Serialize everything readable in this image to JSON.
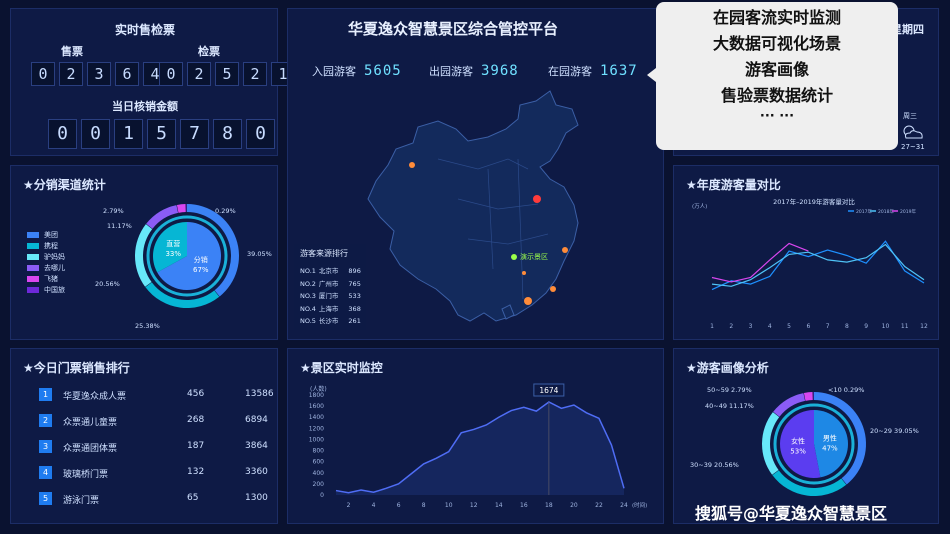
{
  "header": {
    "title": "华夏逸众智慧景区综合管控平台",
    "date_fragment": "星期四"
  },
  "ticket_panel": {
    "title": "实时售检票",
    "sale_label": "售票",
    "sale_digits": [
      "0",
      "2",
      "3",
      "6",
      "4"
    ],
    "check_label": "检票",
    "check_digits": [
      "0",
      "2",
      "5",
      "2",
      "1"
    ],
    "revenue_label": "当日核销金额",
    "revenue_digits": [
      "0",
      "0",
      "1",
      "5",
      "7",
      "8",
      "0"
    ]
  },
  "visitor_stats": [
    {
      "label": "入园游客",
      "value": "5605"
    },
    {
      "label": "出园游客",
      "value": "3968"
    },
    {
      "label": "在园游客",
      "value": "1637"
    }
  ],
  "popup": {
    "lines": [
      "在园客流实时监测",
      "大数据可视化场景",
      "游客画像",
      "售验票数据统计",
      "··· ···"
    ]
  },
  "weather": {
    "day": "周三",
    "range": "27~31"
  },
  "channel_panel": {
    "title": "★分销渠道统计",
    "legend": [
      {
        "name": "美团",
        "color": "#3b82f6"
      },
      {
        "name": "携程",
        "color": "#06b6d4"
      },
      {
        "name": "驴妈妈",
        "color": "#67e8f9"
      },
      {
        "name": "去哪儿",
        "color": "#8b5cf6"
      },
      {
        "name": "飞猪",
        "color": "#d946ef"
      },
      {
        "name": "中国旅",
        "color": "#6d28d9"
      }
    ],
    "inner": [
      {
        "label": "分销",
        "pct": "67%",
        "value": 67,
        "color": "#3b82f6"
      },
      {
        "label": "直营",
        "pct": "33%",
        "value": 33,
        "color": "#06b6d4"
      }
    ],
    "outer_values": [
      39.05,
      25.38,
      20.56,
      11.17,
      2.79,
      0.29
    ],
    "outer_colors": [
      "#3b82f6",
      "#06b6d4",
      "#67e8f9",
      "#8b5cf6",
      "#d946ef",
      "#6d28d9"
    ],
    "labels": [
      "39.05%",
      "25.38%",
      "20.56%",
      "11.17%",
      "2.79%",
      "0.29%"
    ]
  },
  "map_panel": {
    "demo_label": "演示景区",
    "source_title": "游客来源排行",
    "source_rows": [
      {
        "rank": "NO.1",
        "city": "北京市",
        "count": "896"
      },
      {
        "rank": "NO.2",
        "city": "广州市",
        "count": "765"
      },
      {
        "rank": "NO.3",
        "city": "厦门市",
        "count": "533"
      },
      {
        "rank": "NO.4",
        "city": "上海市",
        "count": "368"
      },
      {
        "rank": "NO.5",
        "city": "长沙市",
        "count": "261"
      }
    ]
  },
  "annual_panel": {
    "title": "★年度游客量对比"
  },
  "ranking_panel": {
    "title": "★今日门票销售排行",
    "rows": [
      {
        "n": "1",
        "name": "华夏逸众成人票",
        "a": "456",
        "b": "13586"
      },
      {
        "n": "2",
        "name": "众票通儿童票",
        "a": "268",
        "b": "6894"
      },
      {
        "n": "3",
        "name": "众票通团体票",
        "a": "187",
        "b": "3864"
      },
      {
        "n": "4",
        "name": "玻璃桥门票",
        "a": "132",
        "b": "3360"
      },
      {
        "n": "5",
        "name": "游泳门票",
        "a": "65",
        "b": "1300"
      }
    ]
  },
  "monitor_panel": {
    "title": "★景区实时监控"
  },
  "portrait_panel": {
    "title": "★游客画像分析",
    "inner": [
      {
        "label": "男性",
        "pct": "47%",
        "value": 47,
        "color": "#1e88e5"
      },
      {
        "label": "女性",
        "pct": "53%",
        "value": 53,
        "color": "#5b3df0"
      }
    ],
    "outer_values": [
      39.05,
      25.38,
      20.56,
      11.17,
      2.79,
      0.29
    ],
    "outer_colors": [
      "#3b82f6",
      "#06b6d4",
      "#67e8f9",
      "#8b5cf6",
      "#d946ef",
      "#6d28d9"
    ],
    "labels": [
      "20~29 39.05%",
      "30~39 20.56%",
      "40~49 11.17%",
      "50~59 2.79%",
      "<10 0.29%"
    ]
  },
  "watermark": "搜狐号@华夏逸众智慧景区",
  "chart_data": [
    {
      "type": "line",
      "title": "2017年–2019年游客量对比",
      "ylabel": "(万人)",
      "x": [
        1,
        2,
        3,
        4,
        5,
        6,
        7,
        8,
        9,
        10,
        11,
        12
      ],
      "ylim": [
        0,
        10
      ],
      "series": [
        {
          "name": "2017年",
          "color": "#1e90ff",
          "values": [
            2.4,
            3.2,
            2.9,
            3.6,
            5.9,
            5.4,
            6.0,
            5.5,
            4.8,
            6.8,
            4.1,
            3.0
          ]
        },
        {
          "name": "2018年",
          "color": "#4fc3f7",
          "values": [
            2.9,
            2.7,
            3.3,
            4.4,
            5.6,
            5.8,
            5.1,
            4.9,
            5.3,
            6.5,
            4.5,
            3.3
          ]
        },
        {
          "name": "2019年",
          "color": "#d946ef",
          "values": [
            3.5,
            3.1,
            3.5,
            5.1,
            6.6,
            5.9,
            null,
            null,
            null,
            null,
            null,
            null
          ]
        }
      ]
    },
    {
      "type": "area",
      "title": "",
      "ylabel": "(人数)",
      "xlabel": "(时间)",
      "ylim": [
        0,
        1800
      ],
      "x": [
        1,
        2,
        3,
        4,
        5,
        6,
        7,
        8,
        9,
        10,
        11,
        12,
        13,
        14,
        15,
        16,
        17,
        18,
        19,
        20,
        21,
        22,
        23,
        24
      ],
      "values": [
        80,
        40,
        90,
        50,
        120,
        200,
        380,
        560,
        660,
        780,
        1120,
        1180,
        1260,
        1400,
        1520,
        1580,
        1510,
        1674,
        1560,
        1620,
        1480,
        1380,
        900,
        120
      ],
      "annotation": {
        "x": 18,
        "label": "1674"
      }
    }
  ]
}
